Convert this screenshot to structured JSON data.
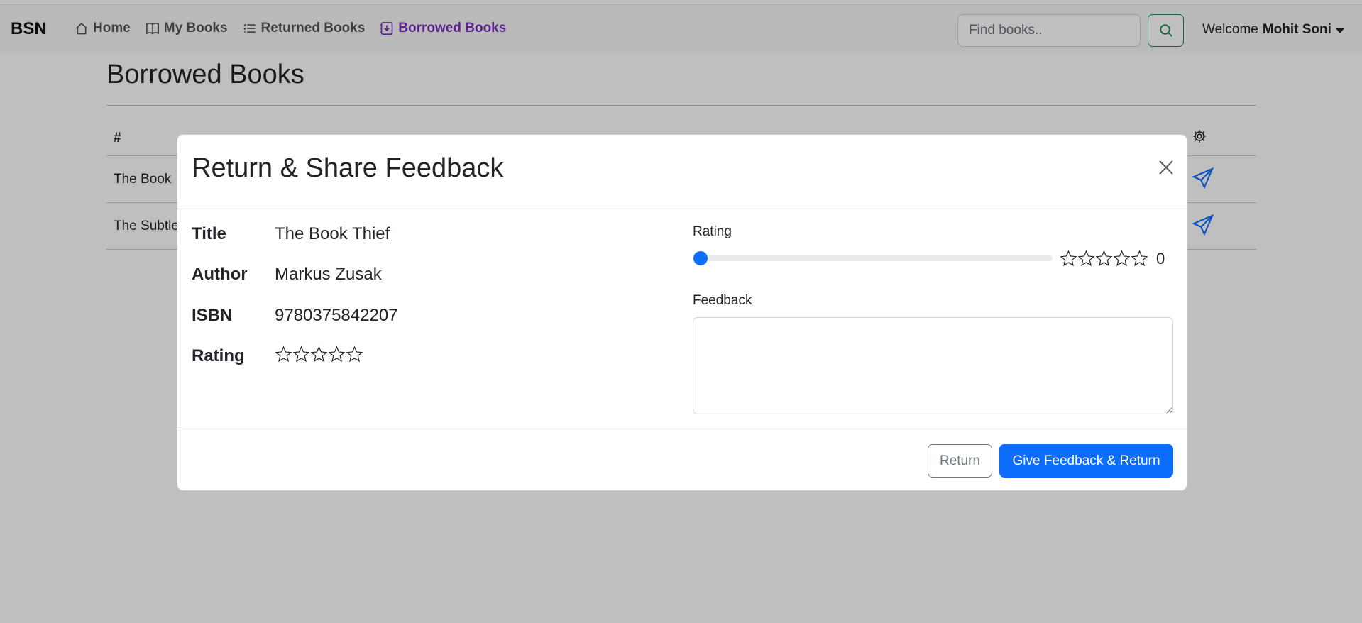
{
  "navbar": {
    "brand": "BSN",
    "links": [
      {
        "label": "Home",
        "icon": "home-icon"
      },
      {
        "label": "My Books",
        "icon": "book-icon"
      },
      {
        "label": "Returned Books",
        "icon": "list-icon"
      },
      {
        "label": "Borrowed Books",
        "icon": "inbox-download-icon",
        "active": true
      }
    ],
    "search_placeholder": "Find books..",
    "welcome_text": "Welcome",
    "user_name": "Mohit Soni"
  },
  "page": {
    "title": "Borrowed Books",
    "table": {
      "header_hash": "#",
      "rows": [
        {
          "title_fragment": "The Book"
        },
        {
          "title_fragment": "The Subtle"
        }
      ]
    }
  },
  "modal": {
    "title": "Return & Share Feedback",
    "details": {
      "title_label": "Title",
      "title_value": "The Book Thief",
      "author_label": "Author",
      "author_value": "Markus Zusak",
      "isbn_label": "ISBN",
      "isbn_value": "9780375842207",
      "rating_label": "Rating",
      "rating_stars": 0
    },
    "form": {
      "rating_label": "Rating",
      "rating_value": "0",
      "rating_fraction": 0,
      "feedback_label": "Feedback",
      "feedback_value": ""
    },
    "buttons": {
      "return_label": "Return",
      "feedback_return_label": "Give Feedback & Return"
    }
  },
  "colors": {
    "accent": "#0d6efd",
    "active_nav": "#7b2cbf",
    "search_border": "#198754"
  }
}
